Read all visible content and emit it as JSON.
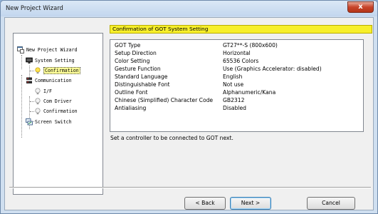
{
  "window": {
    "title": "New Project Wizard",
    "close_label": "x"
  },
  "tree": [
    {
      "label": "New Project Wizard",
      "icon": "project-icon"
    },
    {
      "label": "System Setting",
      "icon": "monitor-icon"
    },
    {
      "label": "Confirmation",
      "icon": "lightbulb-icon",
      "selected": true
    },
    {
      "label": "Communication",
      "icon": "network-icon"
    },
    {
      "label": "I/F",
      "icon": "lightbulb-icon"
    },
    {
      "label": "Com Driver",
      "icon": "lightbulb-icon"
    },
    {
      "label": "Confirmation",
      "icon": "lightbulb-icon"
    },
    {
      "label": "Screen Switch",
      "icon": "screen-switch-icon"
    }
  ],
  "header": {
    "title": "Confirmation of GOT System Setting"
  },
  "settings": [
    {
      "key": "GOT Type",
      "value": "GT27**-S (800x600)"
    },
    {
      "key": "Setup Direction",
      "value": "Horizontal"
    },
    {
      "key": "Color Setting",
      "value": "65536 Colors"
    },
    {
      "key": "Gesture Function",
      "value": "Use (Graphics Accelerator: disabled)"
    },
    {
      "key": "Standard Language",
      "value": "English"
    },
    {
      "key": "Distinguishable Font",
      "value": "Not use"
    },
    {
      "key": "Outline Font",
      "value": "Alphanumeric/Kana"
    },
    {
      "key": "Chinese (Simplified) Character Code",
      "value": "GB2312"
    },
    {
      "key": "Antialiasing",
      "value": "Disabled"
    }
  ],
  "message": "Set a controller to be connected to GOT next.",
  "buttons": {
    "back": "< Back",
    "next": "Next >",
    "cancel": "Cancel"
  }
}
